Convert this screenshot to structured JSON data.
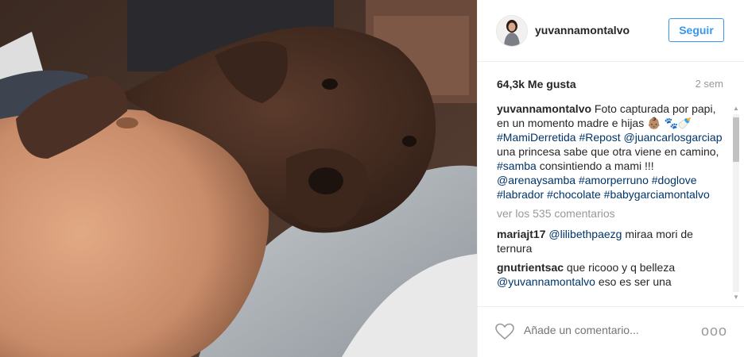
{
  "post": {
    "username": "yuvannamontalvo",
    "follow_label": "Seguir",
    "likes": "64,3k Me gusta",
    "time": "2 sem",
    "caption": {
      "user": "yuvannamontalvo",
      "text1": "Foto capturada por papi, en un momento madre e hijas 👶🏽",
      "emoji": "🐾🍼",
      "tag1": "#MamiDerretida",
      "tag2": "#Repost",
      "mention1": "@juancarlosgarciap",
      "text2": "una princesa sabe que otra viene en camino,",
      "tag3": "#samba",
      "text3": "consintiendo a mami !!!",
      "mention2": "@arenaysamba",
      "tag4": "#amorperruno",
      "tag5": "#doglove",
      "tag6": "#labrador",
      "tag7": "#chocolate",
      "tag8": "#babygarciamontalvo"
    },
    "view_comments": "ver los 535 comentarios",
    "comments": [
      {
        "user": "mariajt17",
        "mention": "@lilibethpaezg",
        "text": "miraa mori de ternura"
      },
      {
        "user": "gnutrientsac",
        "text": "que ricooo y q belleza",
        "mention": "@yuvannamontalvo",
        "text2": "eso es ser una"
      }
    ],
    "add_comment_placeholder": "Añade un comentario...",
    "more_options": "ooo"
  },
  "icons": {
    "like": "heart-icon",
    "options": "more-options-icon",
    "avatar": "profile-avatar"
  },
  "colors": {
    "accent": "#3897f0",
    "link": "#003569",
    "muted": "#999999"
  }
}
